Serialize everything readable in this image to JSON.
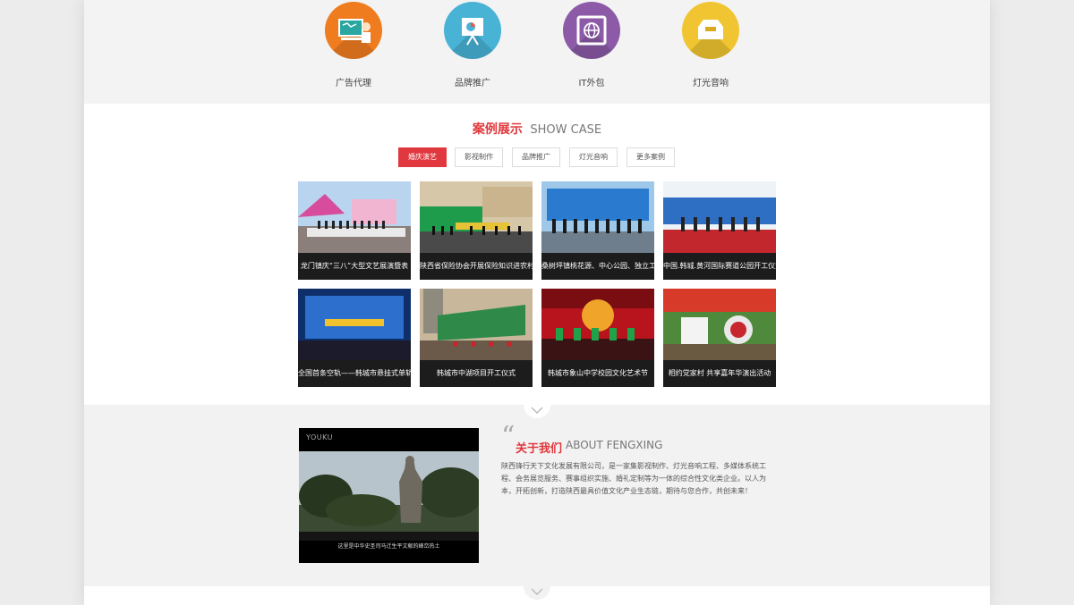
{
  "services": [
    {
      "label": "广告代理",
      "color": "#ef7d1f",
      "icon": "presentation-board-icon"
    },
    {
      "label": "品牌推广",
      "color": "#49b3d6",
      "icon": "easel-chart-icon"
    },
    {
      "label": "IT外包",
      "color": "#8c5aa7",
      "icon": "globe-window-icon"
    },
    {
      "label": "灯光音响",
      "color": "#f0c531",
      "icon": "inbox-tray-icon"
    }
  ],
  "cases": {
    "title_cn": "案例展示",
    "title_en": "SHOW CASE",
    "tabs": [
      "婚庆演艺",
      "影视制作",
      "品牌推广",
      "灯光音响",
      "更多案例"
    ],
    "items": [
      {
        "caption": "龙门镇庆“三八”大型文艺展演暨表",
        "scene": "stage-festival"
      },
      {
        "caption": "陕西省保险协会开展保险知识进农村",
        "scene": "green-banner-event"
      },
      {
        "caption": "桑树坪镇桃花源、中心公园、独立工",
        "scene": "blue-banner-ceremony"
      },
      {
        "caption": "中国.韩城.黄河国际赛道公园开工仪式",
        "scene": "red-carpet-ceremony"
      },
      {
        "caption": "全国首条空轨——韩城市悬挂式单轨",
        "scene": "blue-stage-night"
      },
      {
        "caption": "韩城市中湖项目开工仪式",
        "scene": "building-banner"
      },
      {
        "caption": "韩城市象山中学校园文化艺术节",
        "scene": "red-stage-dance"
      },
      {
        "caption": "相约党家村 共享嘉年华演出活动",
        "scene": "outdoor-performance"
      }
    ]
  },
  "about": {
    "title_cn": "关于我们",
    "title_en": "ABOUT FENGXING",
    "video_logo": "YOUKU",
    "video_subtitle": "这里是中华史圣司马迁生平文献的峰峦热土",
    "text": "陕西锋行天下文化发展有限公司，是一家集影视制作、灯光音响工程、多媒体系统工程、会务展览服务、赛事组织实施、婚礼定制等为一体的综合性文化类企业。以人为本，开拓创新，打造陕西最具价值文化产业生态链，期待与您合作，共创未来！"
  }
}
